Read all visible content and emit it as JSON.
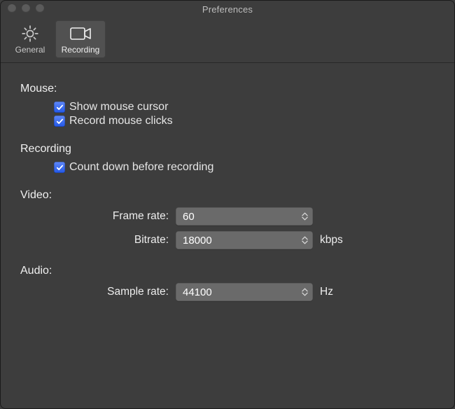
{
  "window": {
    "title": "Preferences"
  },
  "toolbar": {
    "items": [
      {
        "label": "General",
        "icon": "gear-icon",
        "selected": false
      },
      {
        "label": "Recording",
        "icon": "camera-icon",
        "selected": true
      }
    ]
  },
  "sections": {
    "mouse": {
      "title": "Mouse:",
      "options": {
        "show_cursor": {
          "label": "Show mouse cursor",
          "checked": true
        },
        "record_clicks": {
          "label": "Record mouse clicks",
          "checked": true
        }
      }
    },
    "recording": {
      "title": "Recording",
      "options": {
        "countdown": {
          "label": "Count down before recording",
          "checked": true
        }
      }
    },
    "video": {
      "title": "Video:",
      "frame_rate": {
        "label": "Frame rate:",
        "value": "60"
      },
      "bitrate": {
        "label": "Bitrate:",
        "value": "18000",
        "unit": "kbps"
      }
    },
    "audio": {
      "title": "Audio:",
      "sample_rate": {
        "label": "Sample rate:",
        "value": "44100",
        "unit": "Hz"
      }
    }
  }
}
